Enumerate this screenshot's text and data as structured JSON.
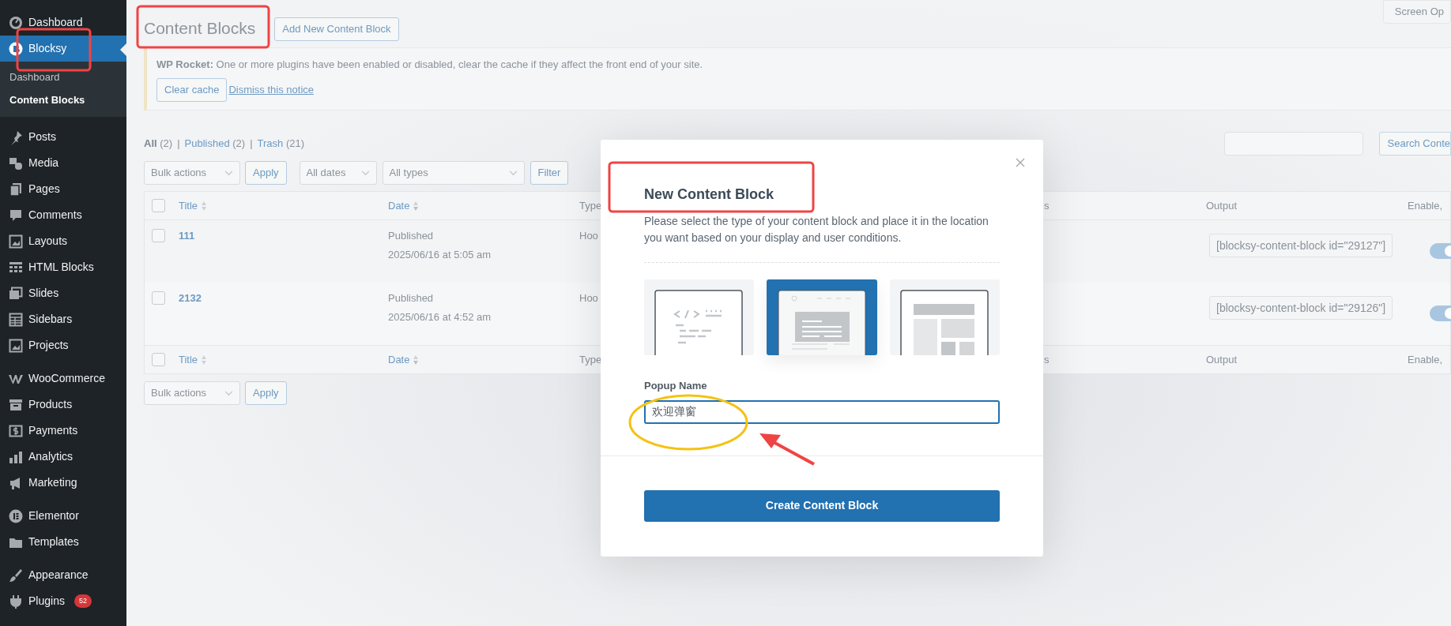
{
  "sidebar": {
    "groups": [
      [
        {
          "label": "Dashboard",
          "selected": false
        },
        {
          "label": "Blocksy",
          "selected": true,
          "children": [
            {
              "label": "Dashboard",
              "selected": false
            },
            {
              "label": "Content Blocks",
              "selected": true
            }
          ]
        }
      ],
      [
        {
          "label": "Posts",
          "selected": false
        },
        {
          "label": "Media",
          "selected": false
        },
        {
          "label": "Pages",
          "selected": false
        },
        {
          "label": "Comments",
          "selected": false
        },
        {
          "label": "Layouts",
          "selected": false
        },
        {
          "label": "HTML Blocks",
          "selected": false
        },
        {
          "label": "Slides",
          "selected": false
        },
        {
          "label": "Sidebars",
          "selected": false
        },
        {
          "label": "Projects",
          "selected": false
        }
      ],
      [
        {
          "label": "WooCommerce",
          "selected": false
        },
        {
          "label": "Products",
          "selected": false
        },
        {
          "label": "Payments",
          "selected": false
        },
        {
          "label": "Analytics",
          "selected": false
        },
        {
          "label": "Marketing",
          "selected": false
        }
      ],
      [
        {
          "label": "Elementor",
          "selected": false
        },
        {
          "label": "Templates",
          "selected": false
        }
      ],
      [
        {
          "label": "Appearance",
          "selected": false
        },
        {
          "label": "Plugins",
          "selected": false,
          "badge": "52"
        }
      ]
    ]
  },
  "header": {
    "title": "Content Blocks",
    "add_button": "Add New Content Block",
    "screen_options": "Screen Op"
  },
  "notice": {
    "source": "WP Rocket:",
    "message": "One or more plugins have been enabled or disabled, clear the cache if they affect the front end of your site.",
    "button": "Clear cache",
    "dismiss": "Dismiss this notice"
  },
  "filters": [
    {
      "label": "All",
      "count": "(2)",
      "selected": true
    },
    {
      "separator": "|",
      "label": "Published",
      "count": "(2)",
      "selected": false
    },
    {
      "separator": "|",
      "label": "Trash",
      "count": "(21)",
      "selected": false
    }
  ],
  "search": {
    "button": "Search Conte"
  },
  "toolbar": {
    "bulk": "Bulk actions",
    "apply": "Apply",
    "dates": "All dates",
    "types": "All types",
    "filter": "Filter"
  },
  "table": {
    "header": {
      "checked": false,
      "columns": [
        "Title",
        "Date",
        "Type",
        "s",
        "Output",
        "Enable,"
      ]
    },
    "rows": [
      {
        "checked": false,
        "title": "111",
        "status": "Published",
        "date": "2025/06/16 at 5:05 am",
        "type": "Hoo",
        "output": "[blocksy-content-block id=\"29127\"]",
        "enabled": true
      },
      {
        "checked": false,
        "title": "2132",
        "status": "Published",
        "date": "2025/06/16 at 4:52 am",
        "type": "Hoo",
        "output": "[blocksy-content-block id=\"29126\"]",
        "enabled": true
      }
    ],
    "footer": {
      "checked": false,
      "columns": [
        "Title",
        "Date",
        "Type",
        "s",
        "Output",
        "Enable,"
      ]
    }
  },
  "bottom_toolbar": {
    "bulk": "Bulk actions",
    "apply": "Apply"
  },
  "modal": {
    "title": "New Content Block",
    "description": "Please select the type of your content block and place it in the location you want based on your display and user conditions.",
    "options": [
      {
        "kind": "hook",
        "selected": false
      },
      {
        "kind": "popup",
        "selected": true
      },
      {
        "kind": "content",
        "selected": false
      }
    ],
    "field_label": "Popup Name",
    "field_value": "欢迎弹窗",
    "submit": "Create Content Block"
  }
}
